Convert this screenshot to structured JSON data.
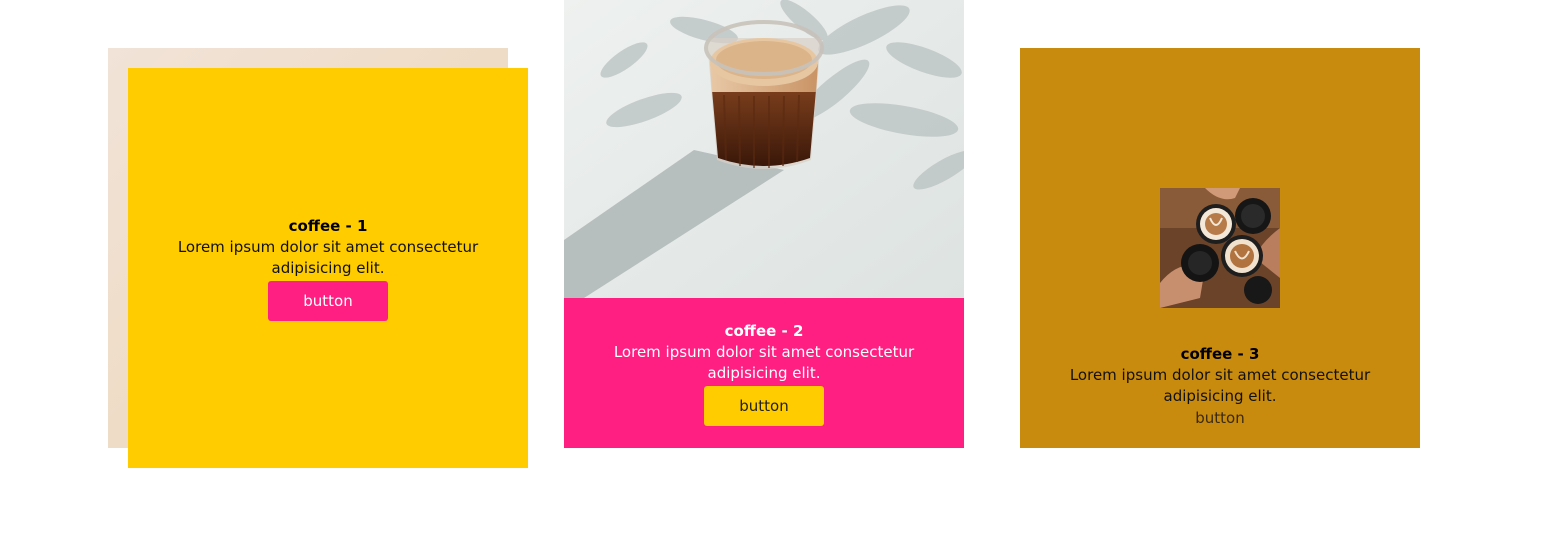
{
  "cards": [
    {
      "title": "coffee - 1",
      "description": "Lorem ipsum dolor sit amet consectetur adipisicing elit.",
      "button_label": "button"
    },
    {
      "title": "coffee - 2",
      "description": "Lorem ipsum dolor sit amet consectetur adipisicing elit.",
      "button_label": "button"
    },
    {
      "title": "coffee - 3",
      "description": "Lorem ipsum dolor sit amet consectetur adipisicing elit.",
      "button_label": "button"
    }
  ],
  "colors": {
    "card1_bg": "#ffcc00",
    "card1_shadow": "#efdcc6",
    "card2_bg": "#ff1e82",
    "card3_bg": "#c98b0d",
    "button_pink": "#ff1e82",
    "button_yellow": "#ffcc00"
  }
}
